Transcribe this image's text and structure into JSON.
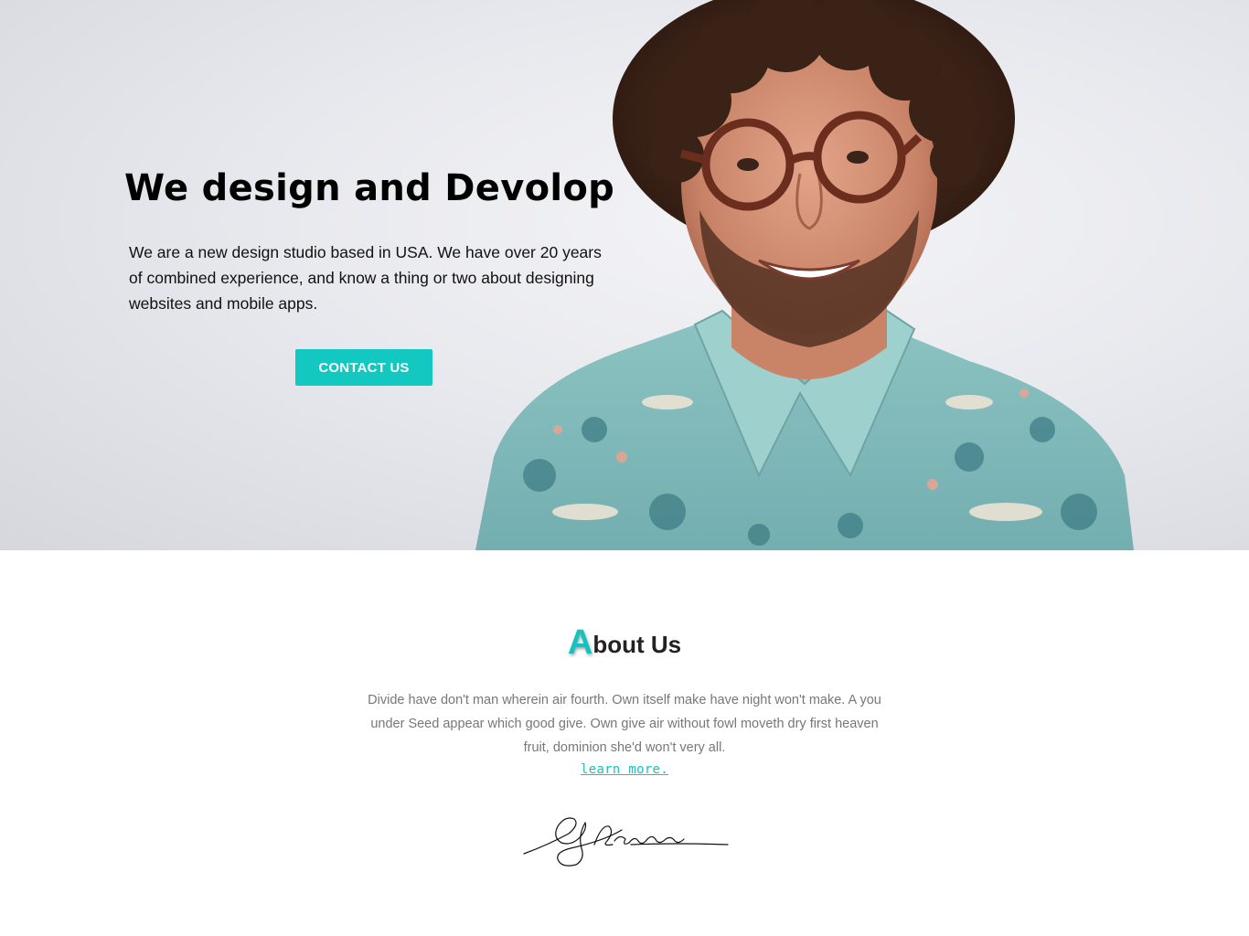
{
  "hero": {
    "title": "We design and Devolop",
    "text": "We are a new design studio based in USA. We have over 20 years of combined experience, and know a thing or two about designing websites and mobile apps.",
    "cta_label": "CONTACT US"
  },
  "about": {
    "title_initial": "A",
    "title_rest": "bout Us",
    "text": "Divide have don't man wherein air fourth. Own itself make have night won't make. A you under Seed appear which good give. Own give air without fowl moveth dry first heaven fruit, dominion she'd won't very all.",
    "link_label": "learn more."
  },
  "colors": {
    "accent": "#12c8c1",
    "heading": "#000000",
    "body_text": "#777777"
  }
}
